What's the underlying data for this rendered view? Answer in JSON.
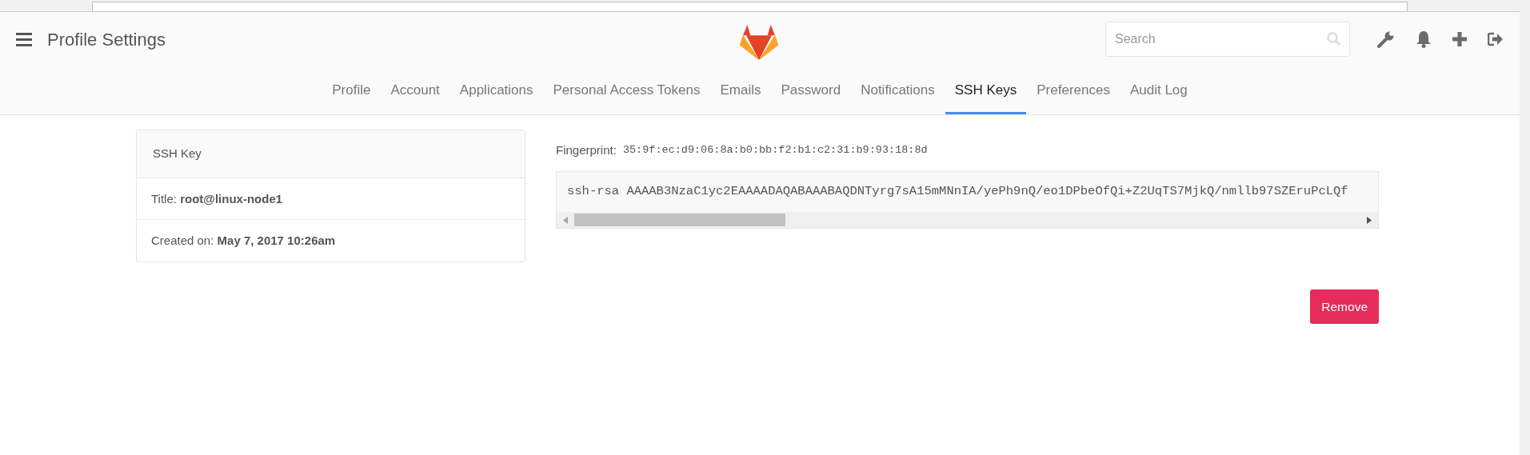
{
  "header": {
    "title": "Profile Settings",
    "search": {
      "placeholder": "Search"
    }
  },
  "tabs": [
    {
      "label": "Profile",
      "selected": false
    },
    {
      "label": "Account",
      "selected": false
    },
    {
      "label": "Applications",
      "selected": false
    },
    {
      "label": "Personal Access Tokens",
      "selected": false
    },
    {
      "label": "Emails",
      "selected": false
    },
    {
      "label": "Password",
      "selected": false
    },
    {
      "label": "Notifications",
      "selected": false
    },
    {
      "label": "SSH Keys",
      "selected": true
    },
    {
      "label": "Preferences",
      "selected": false
    },
    {
      "label": "Audit Log",
      "selected": false
    }
  ],
  "key_card": {
    "heading": "SSH Key",
    "rows": [
      {
        "label": "Title:",
        "value": "root@linux-node1"
      },
      {
        "label": "Created on:",
        "value": "May 7, 2017 10:26am"
      }
    ]
  },
  "fingerprint": {
    "label": "Fingerprint:",
    "value": "35:9f:ec:d9:06:8a:b0:bb:f2:b1:c2:31:b9:93:18:8d"
  },
  "public_key": "ssh-rsa AAAAB3NzaC1yc2EAAAADAQABAAABAQDNTyrg7sA15mMNnIA/yePh9nQ/eo1DPbeOfQi+Z2UqTS7MjkQ/nmllb97SZEruPcLQf",
  "remove_button": "Remove"
}
